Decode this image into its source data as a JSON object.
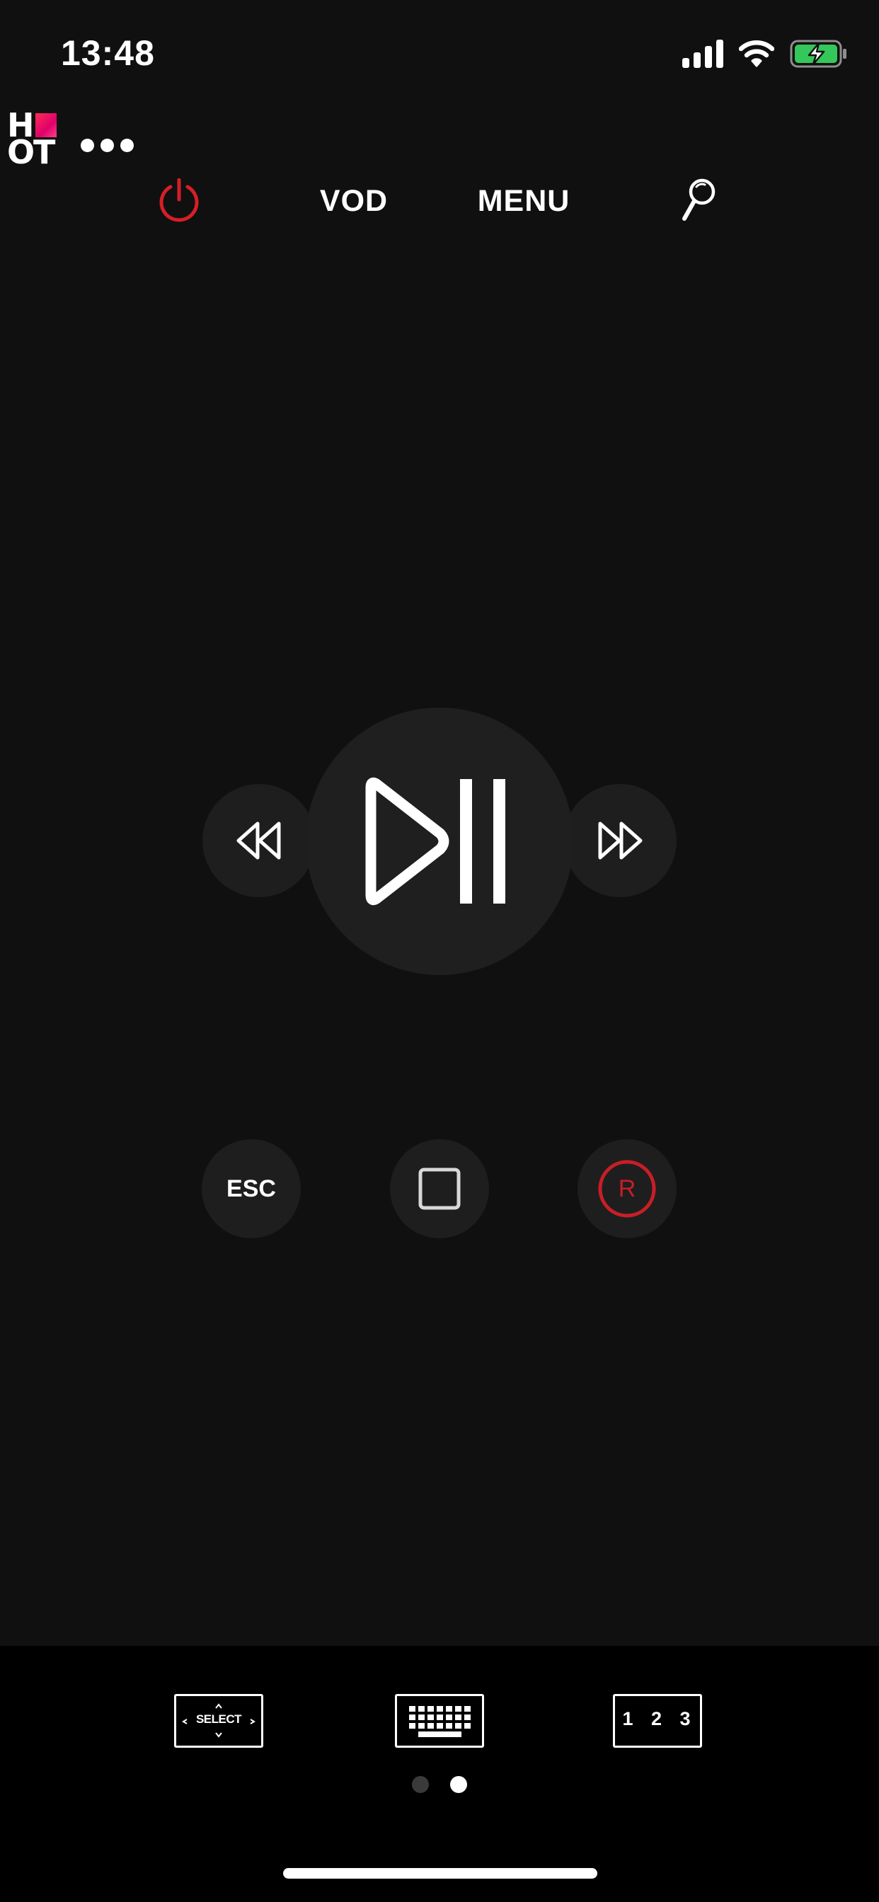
{
  "status_bar": {
    "time": "13:48",
    "icons": [
      "signal-icon",
      "wifi-icon",
      "battery-charging-icon"
    ],
    "battery_color": "#34c759"
  },
  "header": {
    "logo_letters": [
      "H",
      "O",
      "T"
    ],
    "more_icon": "more-dots-icon"
  },
  "nav": {
    "power_icon": "power-icon",
    "vod_label": "VOD",
    "menu_label": "MENU",
    "search_icon": "search-icon"
  },
  "playback": {
    "rewind_icon": "rewind-icon",
    "play_pause_icon": "play-pause-icon",
    "fast_forward_icon": "fast-forward-icon"
  },
  "controls": {
    "esc_label": "ESC",
    "stop_icon": "stop-icon",
    "record_label": "R"
  },
  "toolbar": {
    "select_label": "SELECT",
    "keyboard_icon": "keyboard-icon",
    "keypad_label": "1 2 3"
  },
  "pager": {
    "count": 2,
    "active_index": 1
  },
  "colors": {
    "background": "#101010",
    "button": "#1e1e1e",
    "accent_red": "#d61f26",
    "bottom_panel": "#000000"
  }
}
